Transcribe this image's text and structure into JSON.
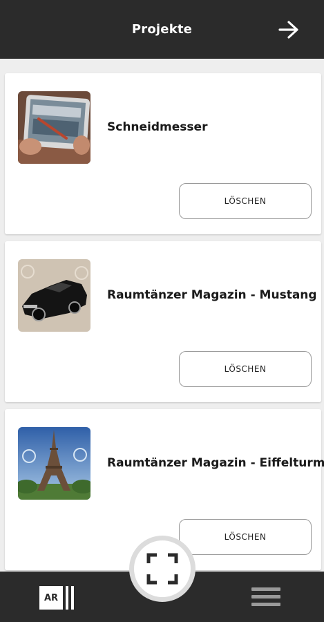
{
  "header": {
    "title": "Projekte",
    "forward_icon": "arrow-right-icon"
  },
  "projects": [
    {
      "title": "Schneidmesser",
      "delete_label": "LÖSCHEN",
      "thumbnail": "tablet-photo"
    },
    {
      "title": "Raumtänzer Magazin - Mustang",
      "delete_label": "LÖSCHEN",
      "thumbnail": "car-photo"
    },
    {
      "title": "Raumtänzer Magazin - Eiffelturm",
      "delete_label": "LÖSCHEN",
      "thumbnail": "eiffel-tower-photo"
    }
  ],
  "bottom_nav": {
    "ar_label": "AR",
    "scan_icon": "scan-frame-icon",
    "menu_icon": "hamburger-menu-icon"
  },
  "colors": {
    "bar_background": "#2b2b2b",
    "page_background": "#eeeeee",
    "card_background": "#ffffff"
  }
}
